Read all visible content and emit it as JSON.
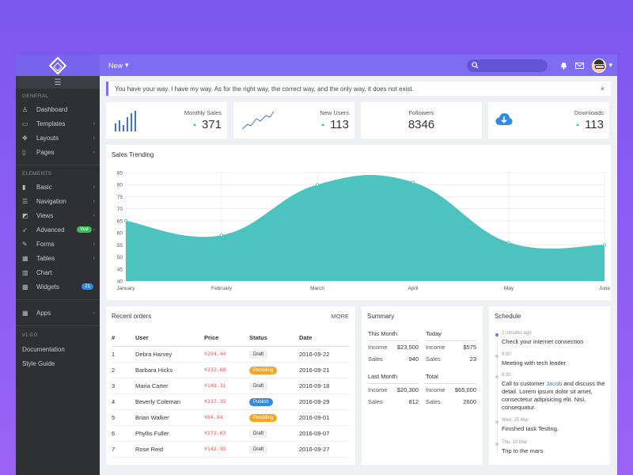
{
  "topbar": {
    "new_label": "New",
    "search_placeholder": ""
  },
  "sidebar": {
    "section_general": "GENERAL",
    "general": [
      {
        "label": "Dashboard",
        "icon": "dashboard-icon",
        "arrow": ""
      },
      {
        "label": "Templates",
        "icon": "templates-icon",
        "arrow": "›"
      },
      {
        "label": "Layouts",
        "icon": "layouts-icon",
        "arrow": "›"
      },
      {
        "label": "Pages",
        "icon": "pages-icon",
        "arrow": "›"
      }
    ],
    "section_elements": "ELEMENTS",
    "elements": [
      {
        "label": "Basic",
        "icon": "basic-icon",
        "arrow": "›"
      },
      {
        "label": "Navigation",
        "icon": "navigation-icon",
        "arrow": "›"
      },
      {
        "label": "Views",
        "icon": "views-icon",
        "arrow": "›"
      },
      {
        "label": "Advanced",
        "icon": "advanced-icon",
        "badge": "Vue",
        "badge_color": "#3dba5a",
        "arrow": "›"
      },
      {
        "label": "Forms",
        "icon": "forms-icon",
        "arrow": "›"
      },
      {
        "label": "Tables",
        "icon": "tables-icon",
        "arrow": "›"
      },
      {
        "label": "Chart",
        "icon": "chart-icon",
        "arrow": ""
      },
      {
        "label": "Widgets",
        "icon": "widgets-icon",
        "badge": "21",
        "badge_color": "#2f8be6",
        "arrow": ""
      }
    ],
    "apps": {
      "label": "Apps",
      "arrow": "›"
    },
    "version": "v1.0.0",
    "documentation": "Documentation",
    "style_guide": "Style Guide"
  },
  "alert": {
    "text": "You have your way. I have my way. As for the right way, the correct way, and the only way, it does not exist.",
    "close": "×"
  },
  "stats": {
    "monthly_sales": {
      "label": "Monthly Sales",
      "value": "371",
      "trend": "▲"
    },
    "new_users": {
      "label": "New Users",
      "value": "113",
      "trend": "▲"
    },
    "followers": {
      "label": "Followers",
      "value": "8346"
    },
    "downloads": {
      "label": "Downloads",
      "value": "113",
      "trend": "▲"
    },
    "sales_bars": [
      9,
      13,
      7,
      17,
      21,
      24
    ]
  },
  "chart_data": {
    "type": "area",
    "title": "Sales Trending",
    "x": [
      "January",
      "February",
      "March",
      "April",
      "May",
      "June"
    ],
    "values": [
      65,
      59,
      80,
      81,
      56,
      55
    ],
    "ylim": [
      40,
      85
    ],
    "yticks": [
      40,
      45,
      50,
      55,
      60,
      65,
      70,
      75,
      80,
      85
    ],
    "grid": true,
    "fill_color": "#4cc3bf"
  },
  "orders": {
    "title": "Recent orders",
    "more": "MORE",
    "columns": [
      "#",
      "User",
      "Price",
      "Status",
      "Date"
    ],
    "rows": [
      {
        "n": "1",
        "user": "Debra Harvey",
        "price": "¥294.44",
        "status": "Draft",
        "date": "2016-09-22"
      },
      {
        "n": "2",
        "user": "Barbara Hicks",
        "price": "¥232.68",
        "status": "Pendding",
        "date": "2016-09-21"
      },
      {
        "n": "3",
        "user": "Maria Carter",
        "price": "¥148.31",
        "status": "Draft",
        "date": "2016-09-18"
      },
      {
        "n": "4",
        "user": "Beverly Coleman",
        "price": "¥237.35",
        "status": "Publish",
        "date": "2016-09-29"
      },
      {
        "n": "5",
        "user": "Brian Walker",
        "price": "¥84.84",
        "status": "Pendding",
        "date": "2016-09-01"
      },
      {
        "n": "6",
        "user": "Phyllis Fuller",
        "price": "¥272.63",
        "status": "Draft",
        "date": "2016-09-07"
      },
      {
        "n": "7",
        "user": "Rose Reid",
        "price": "¥142.95",
        "status": "Draft",
        "date": "2016-09-27"
      }
    ]
  },
  "summary": {
    "title": "Summary",
    "this_month": {
      "title": "This Month",
      "income": "$23,500",
      "sales": "940"
    },
    "today": {
      "title": "Today",
      "income": "$575",
      "sales": "23"
    },
    "last_month": {
      "title": "Last Month",
      "income": "$20,300",
      "sales": "812"
    },
    "total": {
      "title": "Total",
      "income": "$65,000",
      "sales": "2600"
    },
    "income_label": "Income",
    "sales_label": "Sales"
  },
  "schedule": {
    "title": "Schedule",
    "items": [
      {
        "time": "2 minutes ago",
        "text": "Check your internet connection",
        "active": true
      },
      {
        "time": "9:30",
        "text": "Meeting with tech leader"
      },
      {
        "time": "8:30",
        "pre": "Call to customer ",
        "link": "Jacob",
        "text": " and discuss the detail. Lorem ipsum dolor sit amet, consectetur adipisicing elit. Nisi, consequatur."
      },
      {
        "time": "Wed, 25 Mar",
        "text": "Finished task Testing."
      },
      {
        "time": "Thu, 10 Mar",
        "text": "Trip to the mars"
      }
    ]
  }
}
